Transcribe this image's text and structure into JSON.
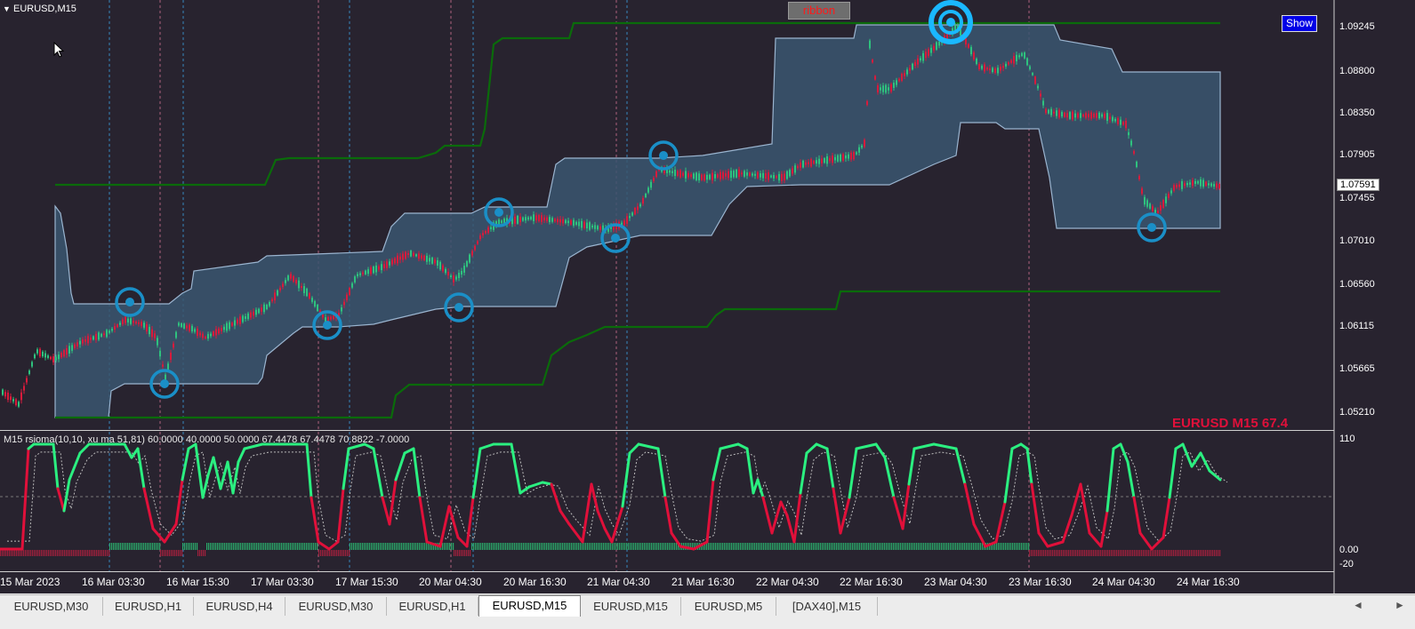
{
  "window": {
    "title": "EURUSD,M15",
    "collapse_icon": "triangle-down-icon"
  },
  "buttons": {
    "ribbon": "ribbon",
    "show": "Show"
  },
  "overlay_label": "EURUSD M15  67.4",
  "current_price": "1.07591",
  "price_axis": [
    "1.09245",
    "1.08800",
    "1.08350",
    "1.07905",
    "1.07455",
    "1.07010",
    "1.06560",
    "1.06115",
    "1.05665",
    "1.05210"
  ],
  "indicator": {
    "caption": "M15  rsioma(10,10, xu ma 51,81) 60.0000 40.0000 50.0000 67.4478 67.4478 70.8822 -7.0000",
    "axis": [
      "110",
      "0.00",
      "-20"
    ]
  },
  "time_axis": [
    "15 Mar 2023",
    "16 Mar 03:30",
    "16 Mar 15:30",
    "17 Mar 03:30",
    "17 Mar 15:30",
    "20 Mar 04:30",
    "20 Mar 16:30",
    "21 Mar 04:30",
    "21 Mar 16:30",
    "22 Mar 04:30",
    "22 Mar 16:30",
    "23 Mar 04:30",
    "23 Mar 16:30",
    "24 Mar 04:30",
    "24 Mar 16:30"
  ],
  "tabs": [
    {
      "label": "EURUSD,M30",
      "active": false
    },
    {
      "label": "EURUSD,H1",
      "active": false
    },
    {
      "label": "EURUSD,H4",
      "active": false
    },
    {
      "label": "EURUSD,M30",
      "active": false
    },
    {
      "label": "EURUSD,H1",
      "active": false
    },
    {
      "label": "EURUSD,M15",
      "active": true
    },
    {
      "label": "EURUSD,M15",
      "active": false
    },
    {
      "label": "EURUSD,M5",
      "active": false
    },
    {
      "label": "[DAX40],M15",
      "active": false
    }
  ],
  "tab_nav": {
    "left": "◄",
    "right": "►"
  },
  "colors": {
    "background": "#28232f",
    "ribbon_fill": "#3a5670",
    "ribbon_edge": "#9ab4cf",
    "channel": "#0a6b0a",
    "bull": "#2ec27e",
    "bear": "#d81b3c",
    "rsi_up": "#2bef80",
    "rsi_down": "#e0103a",
    "marker": "#1a8fc7"
  }
}
